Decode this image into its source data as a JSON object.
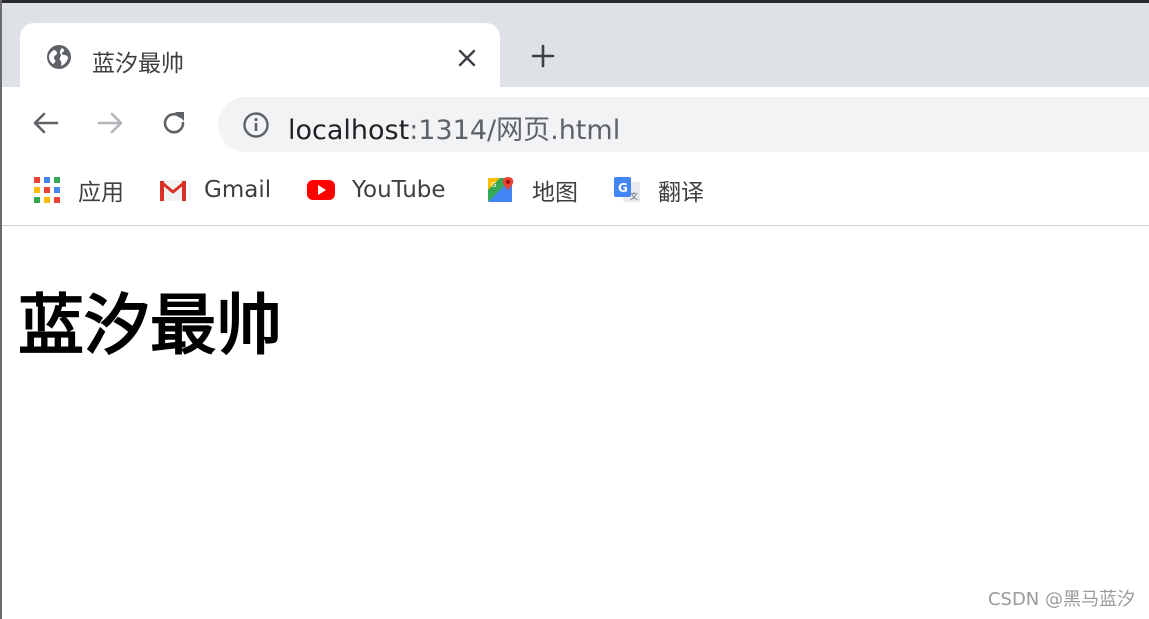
{
  "tab": {
    "title": "蓝汐最帅",
    "favicon": "globe-icon",
    "close_icon": "close-icon"
  },
  "new_tab": {
    "icon": "plus-icon"
  },
  "toolbar": {
    "back_icon": "back-arrow-icon",
    "forward_icon": "forward-arrow-icon",
    "reload_icon": "reload-icon"
  },
  "address_bar": {
    "info_icon": "info-icon",
    "host": "localhost",
    "rest": ":1314/网页.html"
  },
  "bookmarks": [
    {
      "label": "应用",
      "icon": "apps-grid-icon"
    },
    {
      "label": "Gmail",
      "icon": "gmail-icon"
    },
    {
      "label": "YouTube",
      "icon": "youtube-icon"
    },
    {
      "label": "地图",
      "icon": "maps-icon"
    },
    {
      "label": "翻译",
      "icon": "translate-icon"
    }
  ],
  "page": {
    "heading": "蓝汐最帅"
  },
  "watermark": "CSDN @黑马蓝汐",
  "colors": {
    "tabstrip": "#dee1e6",
    "omnibox": "#f1f3f4",
    "youtube_red": "#ff0000"
  }
}
